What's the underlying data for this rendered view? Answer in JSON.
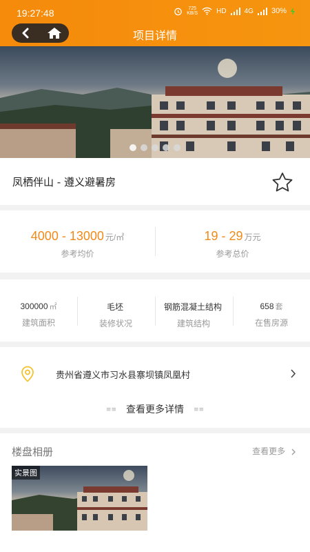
{
  "status": {
    "time": "19:27:48",
    "net_speed_value": "725",
    "net_speed_unit": "KB/S",
    "hd_label": "HD",
    "signal_label": "4G",
    "battery": "30%"
  },
  "nav": {
    "title": "项目详情"
  },
  "hero": {
    "slide_count": 5,
    "active_slide": 0
  },
  "project": {
    "name": "凤栖伴山 - 遵义避暑房"
  },
  "price": {
    "avg_value": "4000 - 13000",
    "avg_unit": "元/㎡",
    "avg_label": "参考均价",
    "total_value": "19 - 29",
    "total_unit": "万元",
    "total_label": "参考总价"
  },
  "stats": [
    {
      "value": "300000",
      "unit": "㎡",
      "label": "建筑面积"
    },
    {
      "value": "毛坯",
      "unit": "",
      "label": "装修状况"
    },
    {
      "value": "钢筋混凝土结构",
      "unit": "",
      "label": "建筑结构"
    },
    {
      "value": "658",
      "unit": "套",
      "label": "在售房源"
    }
  ],
  "address": {
    "text": "贵州省遵义市习水县寨坝镇凤凰村"
  },
  "more_details_label": "查看更多详情",
  "album": {
    "title": "楼盘相册",
    "more_label": "查看更多",
    "photo_tag": "实景图"
  },
  "colors": {
    "header": "#f58a0b",
    "price": "#f08a18",
    "pin": "#f2c230"
  }
}
